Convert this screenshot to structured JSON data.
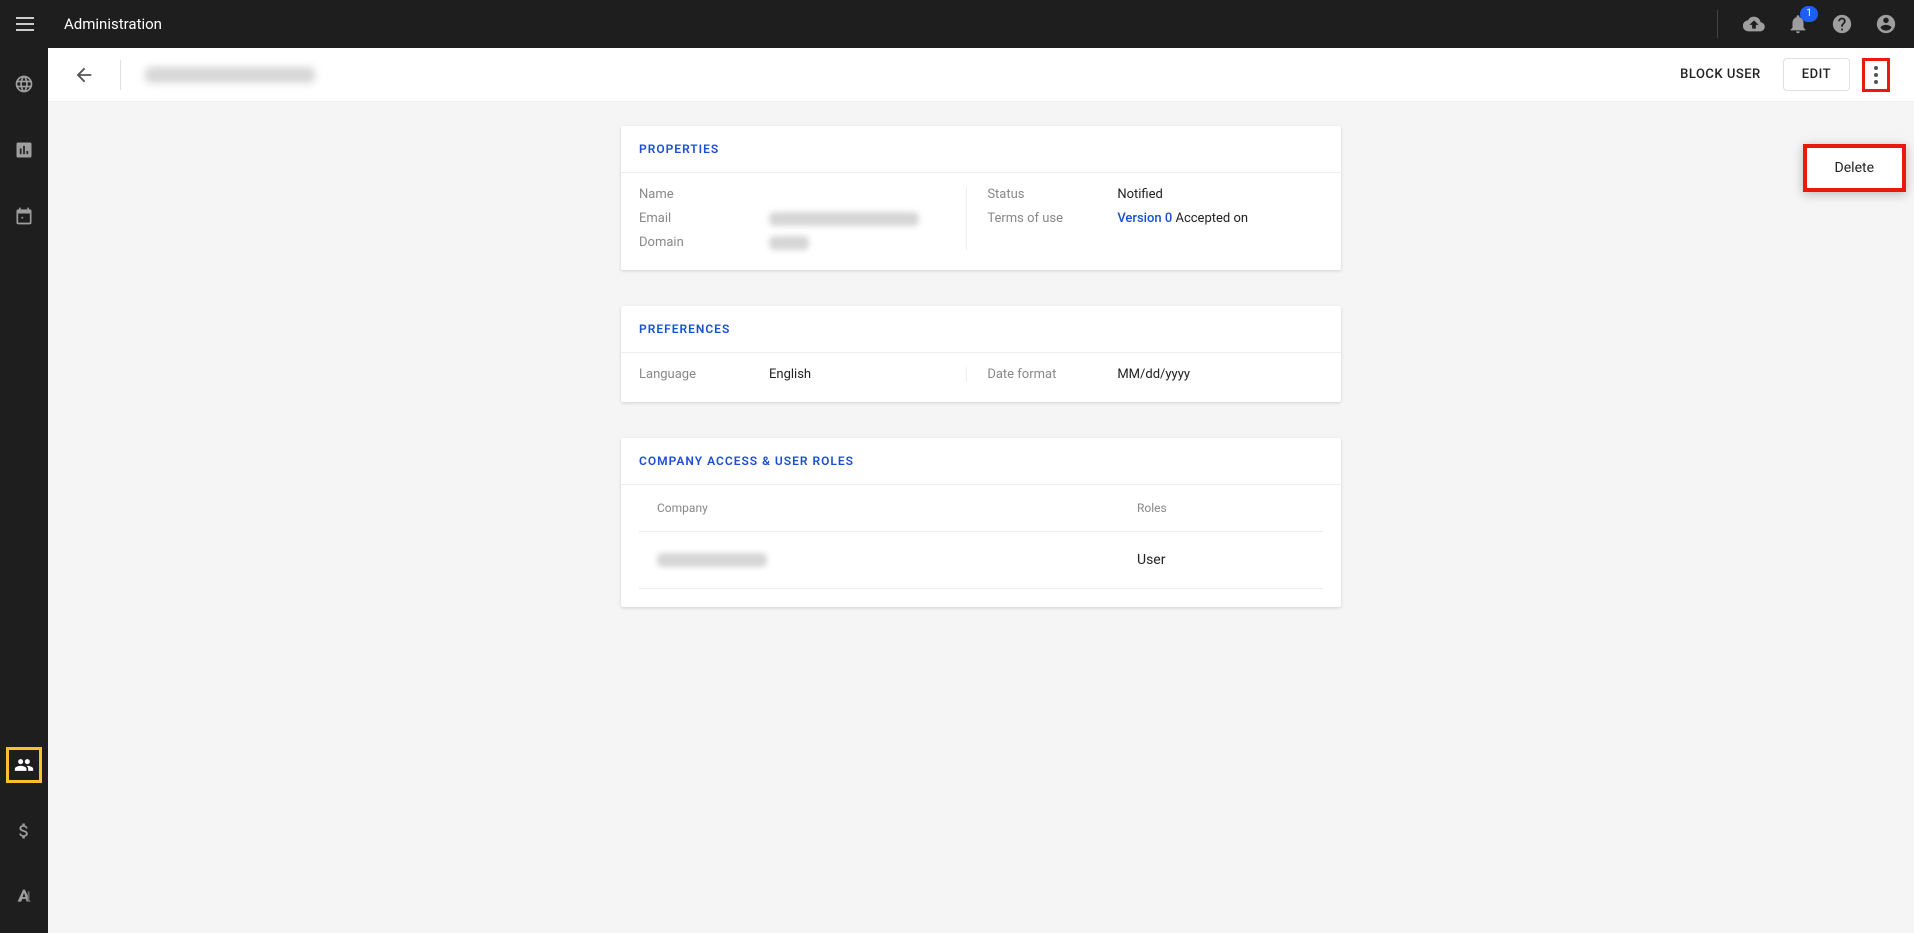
{
  "topbar": {
    "title": "Administration",
    "notification_badge": "1"
  },
  "subheader": {
    "block_user": "BLOCK USER",
    "edit": "EDIT"
  },
  "dropdown": {
    "delete": "Delete"
  },
  "properties": {
    "header": "PROPERTIES",
    "name_label": "Name",
    "email_label": "Email",
    "domain_label": "Domain",
    "status_label": "Status",
    "status_value": "Notified",
    "terms_label": "Terms of use",
    "terms_version": "Version 0",
    "terms_accepted": " Accepted on"
  },
  "preferences": {
    "header": "PREFERENCES",
    "language_label": "Language",
    "language_value": "English",
    "date_label": "Date format",
    "date_value": "MM/dd/yyyy"
  },
  "roles": {
    "header": "COMPANY ACCESS & USER ROLES",
    "company_header": "Company",
    "roles_header": "Roles",
    "role_value": "User"
  }
}
